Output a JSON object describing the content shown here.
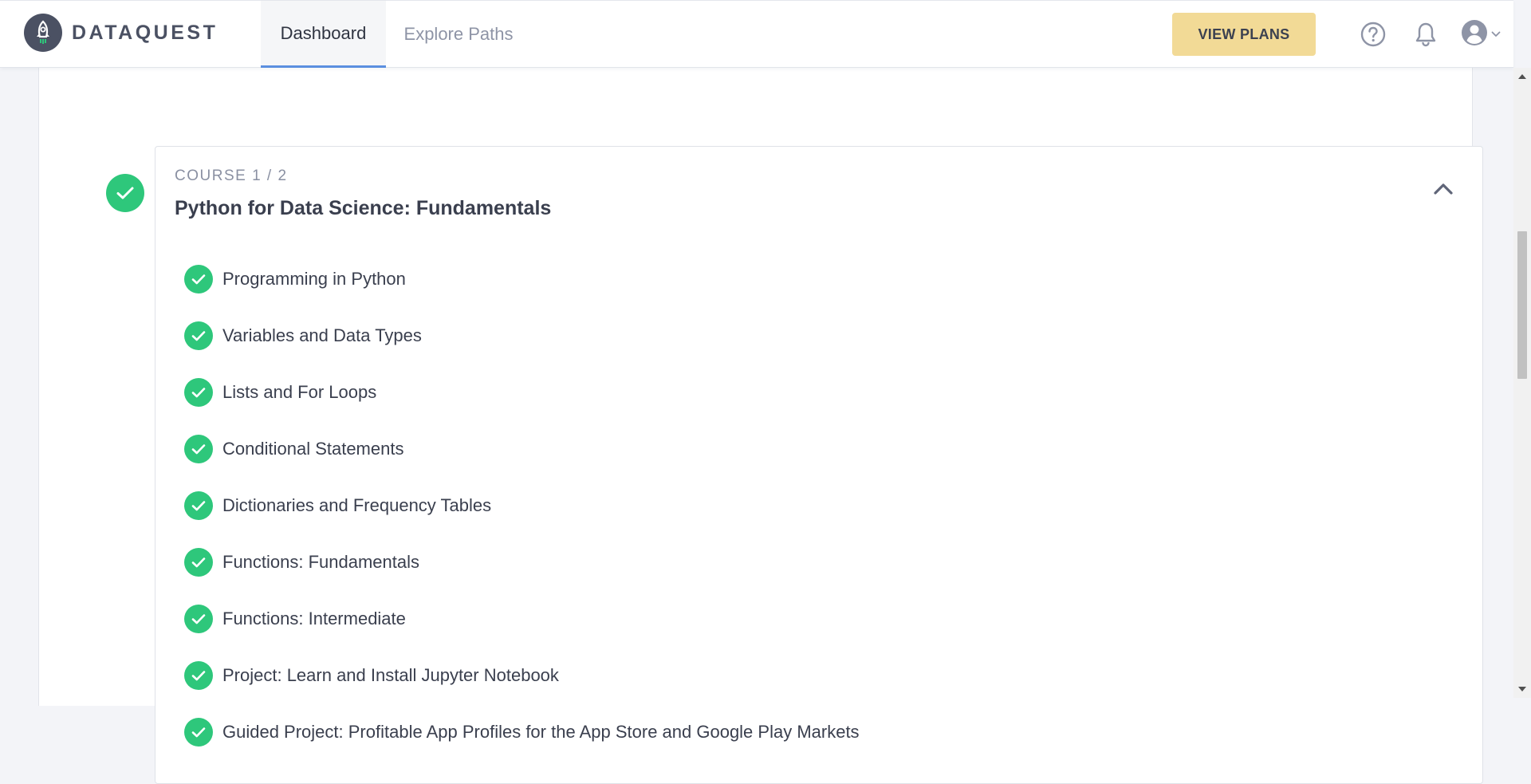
{
  "header": {
    "logo_text": "DATAQUEST",
    "tabs": [
      {
        "label": "Dashboard",
        "active": true
      },
      {
        "label": "Explore Paths",
        "active": false
      }
    ],
    "view_plans_label": "VIEW PLANS",
    "icons": [
      "help-icon",
      "bell-icon",
      "user-avatar-icon",
      "chevron-down-icon"
    ]
  },
  "course": {
    "label": "COURSE 1 / 2",
    "title": "Python for Data Science: Fundamentals",
    "status": "completed",
    "expanded": true,
    "lessons": [
      {
        "title": "Programming in Python",
        "completed": true
      },
      {
        "title": "Variables and Data Types",
        "completed": true
      },
      {
        "title": "Lists and For Loops",
        "completed": true
      },
      {
        "title": "Conditional Statements",
        "completed": true
      },
      {
        "title": "Dictionaries and Frequency Tables",
        "completed": true
      },
      {
        "title": "Functions: Fundamentals",
        "completed": true
      },
      {
        "title": "Functions: Intermediate",
        "completed": true
      },
      {
        "title": "Project: Learn and Install Jupyter Notebook",
        "completed": true
      },
      {
        "title": "Guided Project: Profitable App Profiles for the App Store and Google Play Markets",
        "completed": true
      }
    ]
  },
  "colors": {
    "accent_green": "#2ec77b",
    "plans_button": "#f2da96",
    "active_tab_underline": "#5b8fe0",
    "text_dark": "#3a3f4e",
    "text_muted": "#8a90a2"
  }
}
